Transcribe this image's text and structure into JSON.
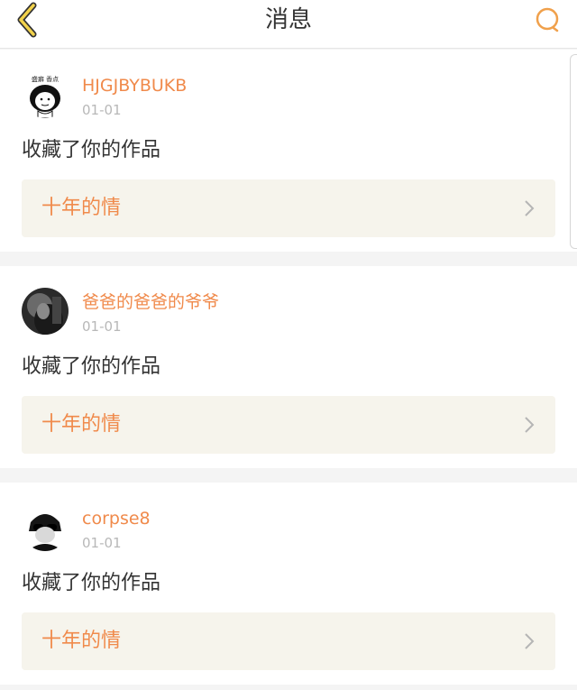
{
  "header": {
    "title": "消息",
    "back_icon": "chevron-left-icon",
    "search_icon": "search-icon",
    "accent_color": "#f0a04b"
  },
  "messages": [
    {
      "username": "HJGJBYBUKB",
      "date": "01-01",
      "action": "收藏了你的作品",
      "work_title": "十年的情",
      "avatar_caption": "盛癖 香点"
    },
    {
      "username": "爸爸的爸爸的爷爷",
      "date": "01-01",
      "action": "收藏了你的作品",
      "work_title": "十年的情"
    },
    {
      "username": "corpse8",
      "date": "01-01",
      "action": "收藏了你的作品",
      "work_title": "十年的情"
    }
  ],
  "colors": {
    "username": "#f08a4b",
    "date": "#b8b8b8",
    "bar_bg": "#f6f4ec",
    "page_bg": "#f4f4f4"
  }
}
